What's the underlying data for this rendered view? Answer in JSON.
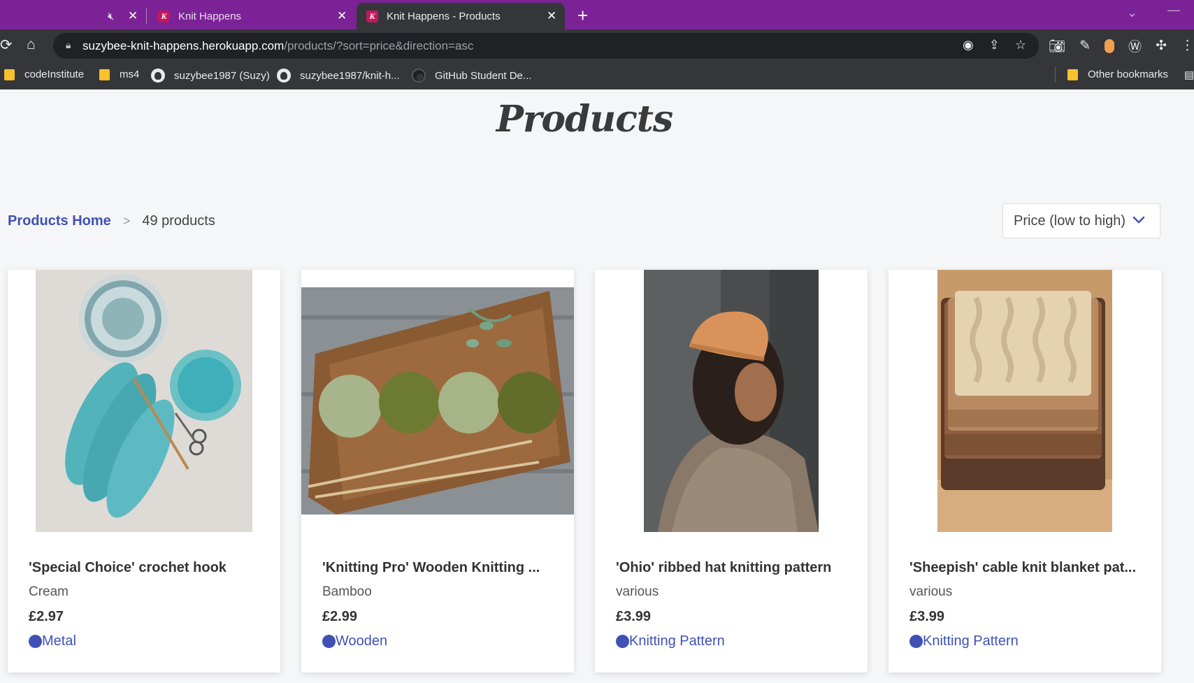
{
  "browser": {
    "tabs": [
      {
        "title": "",
        "muted": true
      },
      {
        "title": "Knit Happens"
      },
      {
        "title": "Knit Happens - Products",
        "active": true
      }
    ],
    "url_domain": "suzybee-knit-happens.herokuapp.com",
    "url_path": "/products/?sort=price&direction=asc",
    "bookmarks": [
      {
        "label": "codeInstitute",
        "icon": "folder-icon"
      },
      {
        "label": "ms4",
        "icon": "folder-icon"
      },
      {
        "label": "suzybee1987 (Suzy)",
        "icon": "github-icon"
      },
      {
        "label": "suzybee1987/knit-h...",
        "icon": "github-icon"
      },
      {
        "label": "GitHub Student De...",
        "icon": "github-icon"
      },
      {
        "label": "Other bookmarks",
        "icon": "folder-icon"
      }
    ],
    "colors": {
      "tabbar": "#7b2296",
      "toolbar": "#35363a"
    }
  },
  "page": {
    "title": "Products",
    "breadcrumb": {
      "home": "Products Home",
      "separator": ">",
      "count": "49 products"
    },
    "sort": {
      "selected": "Price (low to high)"
    },
    "accent": "#3f51b5"
  },
  "products": [
    {
      "name": "'Special Choice' crochet hook",
      "colour": "Cream",
      "price": "£2.97",
      "category": "Metal",
      "image": "teal yarn skeins with crochet hook and bowls"
    },
    {
      "name": "'Knitting Pro' Wooden Knitting ...",
      "colour": "Bamboo",
      "price": "£2.99",
      "category": "Wooden",
      "image": "green yarn balls on wooden board with needles"
    },
    {
      "name": "'Ohio' ribbed hat knitting pattern",
      "colour": "various",
      "price": "£3.99",
      "category": "Knitting Pattern",
      "image": "woman wearing orange ribbed beanie"
    },
    {
      "name": "'Sheepish' cable knit blanket pat...",
      "colour": "various",
      "price": "£3.99",
      "category": "Knitting Pattern",
      "image": "stack of folded knitted blankets"
    }
  ]
}
